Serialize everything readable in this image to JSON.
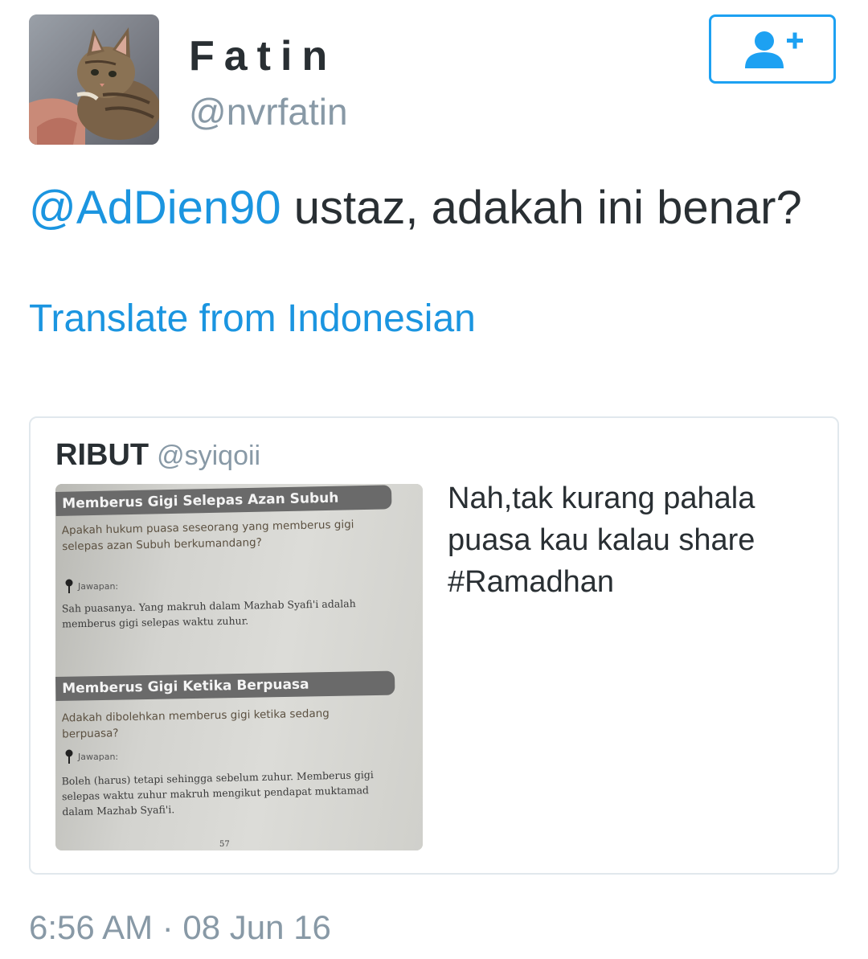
{
  "author": {
    "display_name": "Fatin",
    "handle": "@nvrfatin",
    "avatar": "kitten-avatar"
  },
  "follow_button": {
    "icon": "add-user-icon",
    "color": "#1da1f2"
  },
  "tweet": {
    "mention": "@AdDien90",
    "text": " ustaz, adakah ini benar?",
    "translate_label": "Translate from Indonesian",
    "timestamp": "6:56 AM · 08 Jun 16"
  },
  "quoted_tweet": {
    "name": "RIBUT",
    "handle": "@syiqoii",
    "text": "Nah,tak kurang pahala puasa kau kalau share #Ramadhan",
    "media": {
      "sections": [
        {
          "title": "Memberus Gigi Selepas Azan Subuh",
          "question": "Apakah hukum puasa seseorang yang memberus gigi selepas azan Subuh berkumandang?",
          "answer_label": "Jawapan:",
          "answer": "Sah puasanya. Yang makruh dalam Mazhab Syafi'i adalah memberus gigi selepas waktu zuhur."
        },
        {
          "title": "Memberus Gigi Ketika Berpuasa",
          "question": "Adakah dibolehkan memberus gigi ketika sedang berpuasa?",
          "answer_label": "Jawapan:",
          "answer": "Boleh (harus) tetapi sehingga sebelum zuhur. Memberus gigi selepas waktu zuhur makruh mengikut pendapat muktamad dalam Mazhab Syafi'i."
        }
      ],
      "page_number": "57"
    }
  },
  "colors": {
    "link": "#1b95e0",
    "text": "#292f33",
    "muted": "#8899a6",
    "border": "#e1e8ed"
  }
}
